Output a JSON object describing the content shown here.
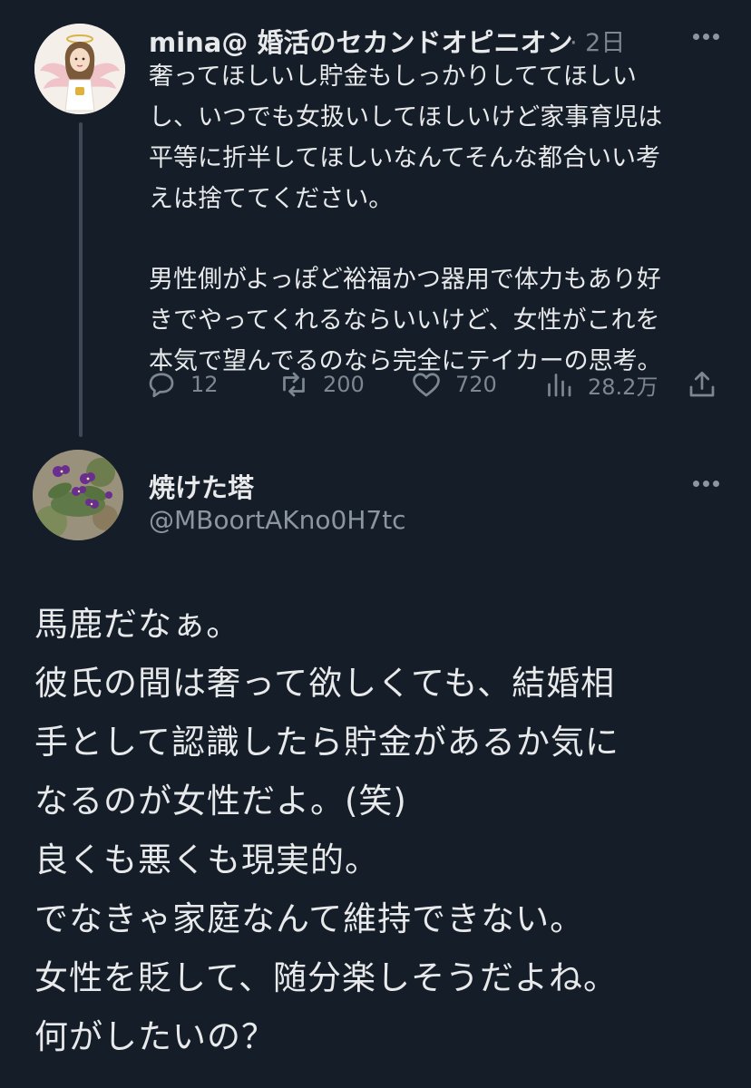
{
  "thread_parent": {
    "display_name": "mina@ 婚活のセカンドオピニオン",
    "time_ago": "· 2日",
    "avatar": "angel-illustration-avatar",
    "text_lines_para1": [
      "奢ってほしいし貯金もしっかりしててほしい",
      "し、いつでも女扱いしてほしいけど家事育児は",
      "平等に折半してほしいなんてそんな都合いい考",
      "えは捨ててください。"
    ],
    "text_lines_para2": [
      "男性側がよっぽど裕福かつ器用で体力もあり好",
      "きでやってくれるならいいけど、女性がこれを",
      "本気で望んでるのなら完全にテイカーの思考。"
    ],
    "actions": {
      "reply_count": "12",
      "retweet_count": "200",
      "like_count": "720",
      "views_count": "28.2万"
    }
  },
  "reply": {
    "display_name": "焼けた塔",
    "handle": "@MBoortAKno0H7tc",
    "avatar": "violet-flowers-avatar",
    "text_lines": [
      "馬鹿だなぁ。",
      "彼氏の間は奢って欲しくても、結婚相",
      "手として認識したら貯金があるか気に",
      "なるのが女性だよ。(笑)",
      "良くも悪くも現実的。",
      "でなきゃ家庭なんて維持できない。",
      "女性を貶して、随分楽しそうだよね。",
      "何がしたいの？"
    ]
  },
  "colors": {
    "background": "#151d28",
    "text": "#e7e9ea",
    "secondary_text": "#7d8792",
    "thread_line": "#3f4854"
  }
}
